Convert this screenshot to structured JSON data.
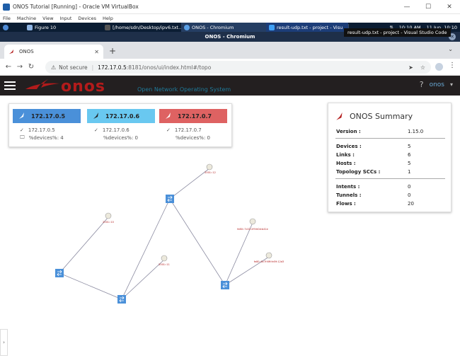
{
  "vbox": {
    "title": "ONOS Tutorial [Running] - Oracle VM VirtualBox",
    "menu": [
      "File",
      "Machine",
      "View",
      "Input",
      "Devices",
      "Help"
    ]
  },
  "taskbar": {
    "items": [
      "Figure 10",
      "[/home/sdn/Desktop/ipv6.txt...",
      "ONOS - Chromium",
      "result-udp.txt - project - Visu"
    ],
    "time": "10:10 AM",
    "date": "11 Jun, 10:10"
  },
  "tooltip": "result-udp.txt - project - Visual Studio Code",
  "chromium": {
    "window_title": "ONOS - Chromium",
    "tab_label": "ONOS",
    "not_secure": "Not secure",
    "url_host": "172.17.0.5",
    "url_path": ":8181/onos/ui/index.html#/topo"
  },
  "masthead": {
    "logo_text": "onos",
    "tagline": "Open Network Operating System",
    "help": "?",
    "user": "onos"
  },
  "instances": [
    {
      "ip": "172.17.0.5",
      "row_ip": "172.17.0.5",
      "row_devices": "%devices%: 4",
      "color": "#4a90d9"
    },
    {
      "ip": "172.17.0.6",
      "row_ip": "172.17.0.6",
      "row_devices": "%devices%: 0",
      "color": "#69c8f0"
    },
    {
      "ip": "172.17.0.7",
      "row_ip": "172.17.0.7",
      "row_devices": "%devices%: 0",
      "color": "#de6262"
    }
  ],
  "summary": {
    "title": "ONOS Summary",
    "version_label": "Version :",
    "version": "1.15.0",
    "devices_label": "Devices :",
    "devices": "5",
    "links_label": "Links :",
    "links": "6",
    "hosts_label": "Hosts :",
    "hosts": "5",
    "scc_label": "Topology SCCs :",
    "scc": "1",
    "intents_label": "Intents :",
    "intents": "0",
    "tunnels_label": "Tunnels :",
    "tunnels": "0",
    "flows_label": "Flows :",
    "flows": "20"
  },
  "colors": {
    "onos_red": "#b31b1b",
    "masthead": "#231f20",
    "switch": "#4a90d9",
    "link": "#8a8aa0"
  }
}
